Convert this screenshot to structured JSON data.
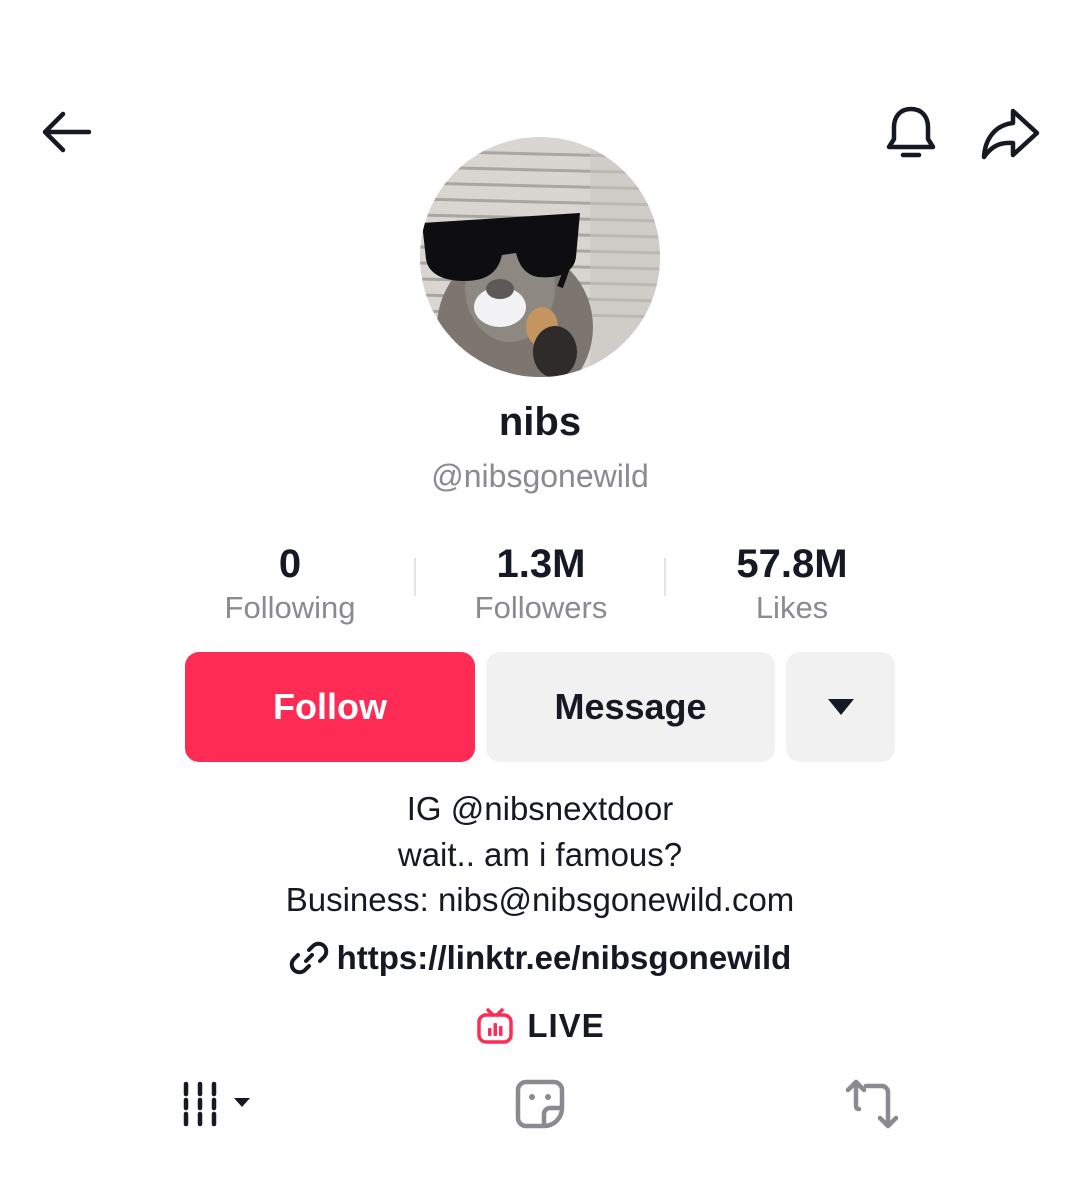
{
  "header": {
    "back_icon": "arrow-left-icon",
    "bell_icon": "bell-icon",
    "share_icon": "share-arrow-icon"
  },
  "profile": {
    "avatar": "squirrel-with-sunglasses",
    "display_name": "nibs",
    "username": "@nibsgonewild"
  },
  "stats": [
    {
      "value": "0",
      "label": "Following"
    },
    {
      "value": "1.3M",
      "label": "Followers"
    },
    {
      "value": "57.8M",
      "label": "Likes"
    }
  ],
  "actions": {
    "follow_label": "Follow",
    "message_label": "Message",
    "more_icon": "caret-down-icon"
  },
  "bio": {
    "lines": [
      "IG @nibsnextdoor",
      "wait.. am i famous?",
      "Business: nibs@nibsgonewild.com"
    ],
    "link": "https://linktr.ee/nibsgonewild",
    "link_icon": "link-icon"
  },
  "live": {
    "label": "LIVE",
    "icon": "live-tv-icon"
  },
  "tabs": [
    {
      "name": "videos",
      "icon": "grid-icon"
    },
    {
      "name": "favorites",
      "icon": "sticker-icon"
    },
    {
      "name": "reposts",
      "icon": "repost-icon"
    }
  ],
  "colors": {
    "accent": "#fe2c55",
    "text": "#161823",
    "secondary_text": "#8a8b91",
    "button_gray": "#f1f1f2"
  }
}
